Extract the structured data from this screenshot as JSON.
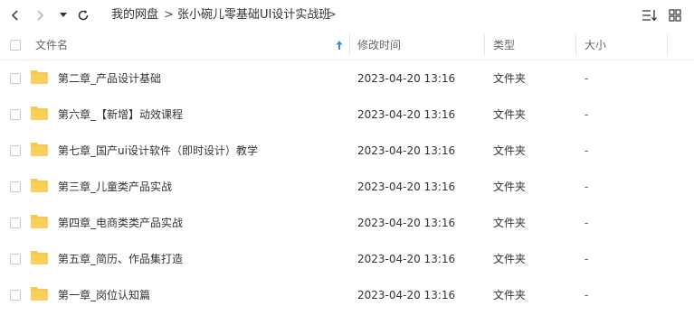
{
  "toolbar": {
    "back_icon": "chevron-left-icon",
    "forward_icon": "chevron-right-icon",
    "history_icon": "caret-down-icon",
    "refresh_icon": "refresh-icon",
    "breadcrumbs": [
      "我的网盘",
      "张小碗儿零基础UI设计实战班"
    ],
    "separator": ">",
    "sort_icon": "sort-list-icon",
    "grid_icon": "grid-view-icon"
  },
  "columns": {
    "name": "文件名",
    "modified": "修改时间",
    "type": "类型",
    "size": "大小",
    "sort_indicator_icon": "sort-ascending-icon"
  },
  "colors": {
    "folder": "#F6C84C",
    "folder_dark": "#EDB73A",
    "sort_arrow": "#3B8BEA"
  },
  "files": [
    {
      "name": "第二章_产品设计基础",
      "modified": "2023-04-20 13:16",
      "type": "文件夹",
      "size": "-"
    },
    {
      "name": "第六章_【新增】动效课程",
      "modified": "2023-04-20 13:16",
      "type": "文件夹",
      "size": "-"
    },
    {
      "name": "第七章_国产ui设计软件（即时设计）教学",
      "modified": "2023-04-20 13:16",
      "type": "文件夹",
      "size": "-"
    },
    {
      "name": "第三章_儿童类产品实战",
      "modified": "2023-04-20 13:16",
      "type": "文件夹",
      "size": "-"
    },
    {
      "name": "第四章_电商类类产品实战",
      "modified": "2023-04-20 13:16",
      "type": "文件夹",
      "size": "-"
    },
    {
      "name": "第五章_简历、作品集打造",
      "modified": "2023-04-20 13:16",
      "type": "文件夹",
      "size": "-"
    },
    {
      "name": "第一章_岗位认知篇",
      "modified": "2023-04-20 13:16",
      "type": "文件夹",
      "size": "-"
    }
  ]
}
